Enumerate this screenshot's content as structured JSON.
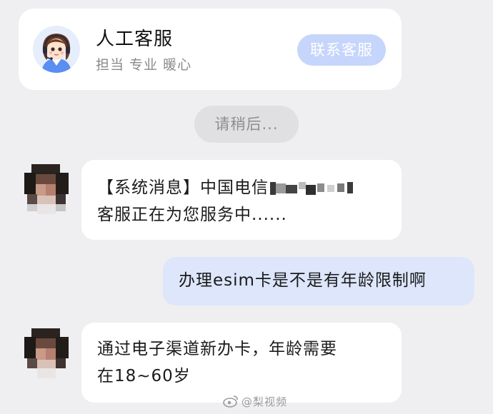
{
  "agent_card": {
    "title": "人工客服",
    "subtitle": "担当 专业 暖心",
    "contact_button": "联系客服",
    "accent_color": "#c6d5fb"
  },
  "wait_status": "请稍后...",
  "messages": [
    {
      "from": "agent",
      "lines": [
        "【系统消息】中国电信",
        "客服正在为您服务中......"
      ],
      "redacted_suffix": true
    },
    {
      "from": "user",
      "lines": [
        "办理esim卡是不是有年龄限制啊"
      ]
    },
    {
      "from": "agent",
      "lines": [
        "通过电子渠道新办卡，年龄需要",
        "在18~60岁"
      ]
    }
  ],
  "watermark": "@梨视频",
  "colors": {
    "background": "#efeff1",
    "user_bubble": "#dde6fb",
    "agent_bubble": "#ffffff"
  }
}
